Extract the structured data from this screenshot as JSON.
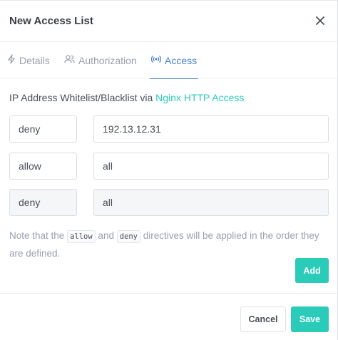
{
  "modal": {
    "title": "New Access List",
    "close_icon": "close-icon"
  },
  "tabs": [
    {
      "label": "Details",
      "icon": "lightning-icon",
      "active": false
    },
    {
      "label": "Authorization",
      "icon": "users-icon",
      "active": false
    },
    {
      "label": "Access",
      "icon": "broadcast-icon",
      "active": true
    }
  ],
  "access": {
    "intro_prefix": "IP Address Whitelist/Blacklist via ",
    "intro_link": "Nginx HTTP Access",
    "rules": [
      {
        "directive": "deny",
        "address": "192.13.12.31",
        "disabled": false
      },
      {
        "directive": "allow",
        "address": "all",
        "disabled": false
      },
      {
        "directive": "deny",
        "address": "all",
        "disabled": true
      }
    ],
    "note_part1": "Note that the ",
    "note_code1": "allow",
    "note_part2": " and ",
    "note_code2": "deny",
    "note_part3": " directives will be applied in the order they are defined.",
    "add_label": "Add"
  },
  "footer": {
    "cancel_label": "Cancel",
    "save_label": "Save"
  },
  "colors": {
    "accent": "#2bcbba",
    "active_tab": "#467fcf",
    "muted_text": "#9aa0ac"
  }
}
